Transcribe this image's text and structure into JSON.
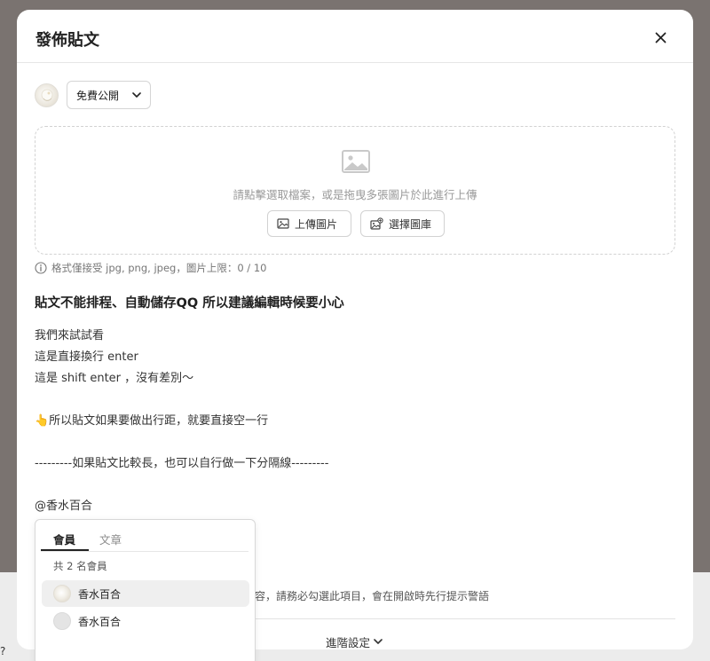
{
  "modal": {
    "title": "發佈貼文",
    "close_icon": "close-icon"
  },
  "composer": {
    "visibility": {
      "selected": "免費公開",
      "icon": "chevron-down-icon"
    }
  },
  "dropzone": {
    "hint": "請點擊選取檔案，或是拖曳多張圖片於此進行上傳",
    "upload_button": "上傳圖片",
    "gallery_button": "選擇圖庫",
    "format_note": "格式僅接受 jpg, png, jpeg，圖片上限：0 / 10"
  },
  "post": {
    "title": "貼文不能排程、自動儲存QQ 所以建議編輯時候要小心",
    "lines": [
      "我們來試試看",
      "這是直接換行 enter",
      "這是 shift enter ，沒有差別～",
      "",
      "👆所以貼文如果要做出行距，就要直接空一行",
      "",
      "---------如果貼文比較長，也可以自行做一下分隔線---------",
      "",
      "@香水百合"
    ]
  },
  "mention_popup": {
    "tabs": [
      "會員",
      "文章"
    ],
    "active_tab": "會員",
    "count_text": "共 2 名會員",
    "members": [
      {
        "name": "香水百合",
        "avatar": "photo"
      },
      {
        "name": "香水百合",
        "avatar": "default"
      }
    ]
  },
  "footer": {
    "warning_text": "容，請務必勾選此項目，會在開啟時先行提示警語",
    "advanced_label": "進階設定"
  },
  "background": {
    "fragment": "?"
  }
}
